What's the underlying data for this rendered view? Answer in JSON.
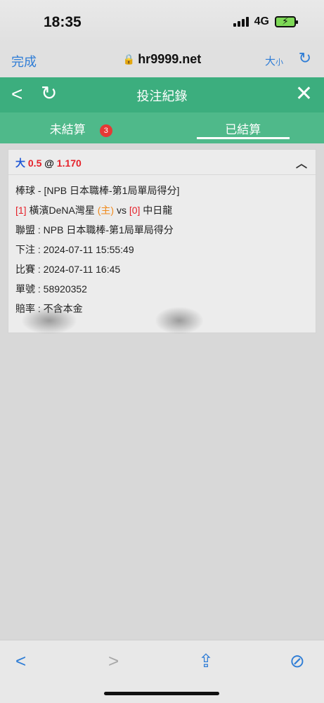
{
  "status": {
    "time": "18:35",
    "network": "4G"
  },
  "browser": {
    "done": "完成",
    "url": "hr9999.net",
    "textsize_big": "大",
    "textsize_small": "小"
  },
  "header": {
    "title": "投注紀錄"
  },
  "tabs": [
    {
      "label": "未結算",
      "badge": "3"
    },
    {
      "label": "已結算",
      "active": true
    }
  ],
  "bet": {
    "selection": "大",
    "line": "0.5",
    "at": "@",
    "odds": "1.170",
    "sport_line": "棒球 - [NPB 日本職棒-第1局單局得分]",
    "home_score": "[1]",
    "home_team": "橫濱DeNA灣星",
    "home_marker": "(主)",
    "vs": "vs",
    "away_score": "[0]",
    "away_team": "中日龍",
    "league": "聯盟 : NPB 日本職棒-第1局單局得分",
    "bet_time": "下注 : 2024-07-11 15:55:49",
    "match_time": "比賽 : 2024-07-11 16:45",
    "ticket": "單號 : 58920352",
    "odds_type": "賠率 : 不含本金"
  },
  "icons": [
    "lock-icon",
    "reload-icon",
    "back-icon",
    "refresh-icon",
    "close-icon",
    "chevron-up-icon",
    "share-icon",
    "compass-icon"
  ],
  "colors": {
    "header_green": "#3cae7e",
    "tab_green": "#4fb98a",
    "ios_blue": "#2f7dd6",
    "badge_red": "#e53935"
  }
}
